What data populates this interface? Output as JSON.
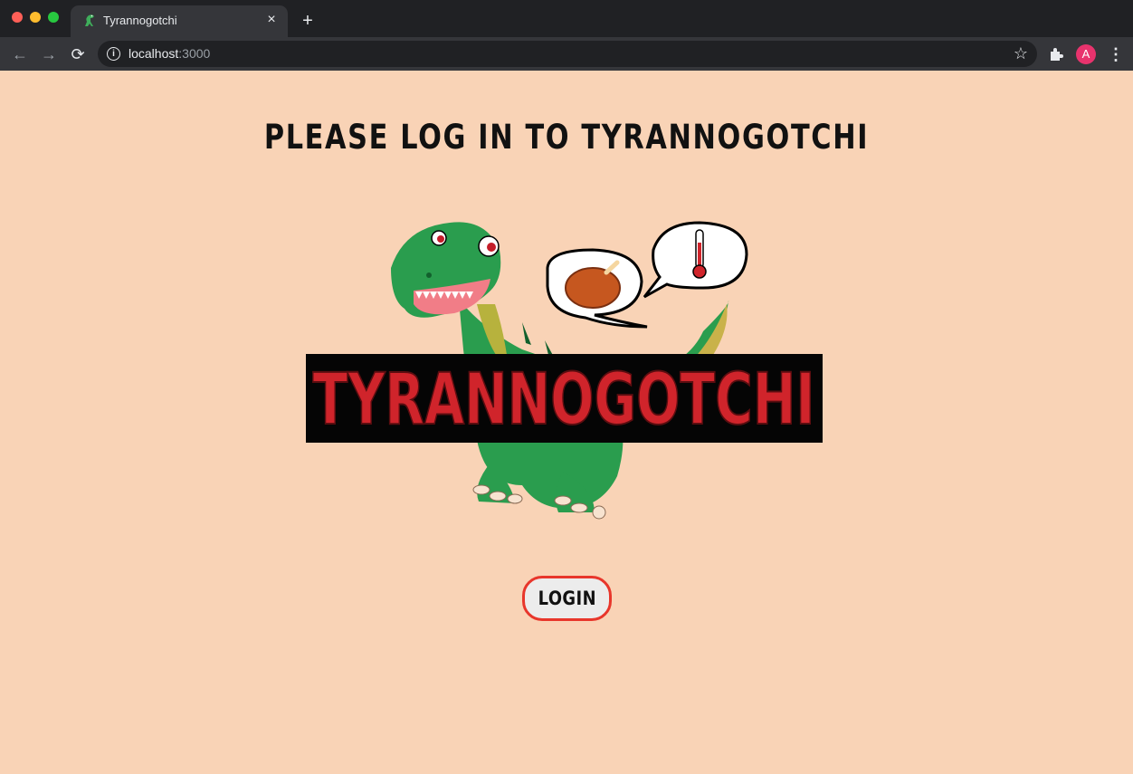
{
  "browser": {
    "tab": {
      "title": "Tyrannogotchi",
      "close_glyph": "×",
      "favicon": "dinosaur-icon"
    },
    "new_tab_glyph": "+",
    "nav": {
      "back_glyph": "←",
      "forward_glyph": "→",
      "reload_glyph": "⟳"
    },
    "address": {
      "host": "localhost",
      "port": ":3000"
    },
    "star_glyph": "☆",
    "avatar_letter": "A",
    "menu_glyph": "⋮"
  },
  "page": {
    "heading": "PLEASE LOG IN TO TYRANNOGOTCHI",
    "logo_text": "TYRANNOGOTCHI",
    "login_label": "LOGIN"
  },
  "colors": {
    "page_bg": "#f9d3b6",
    "dino_green": "#2a9d4e",
    "logo_red": "#d0242b",
    "button_border": "#e8362b"
  }
}
